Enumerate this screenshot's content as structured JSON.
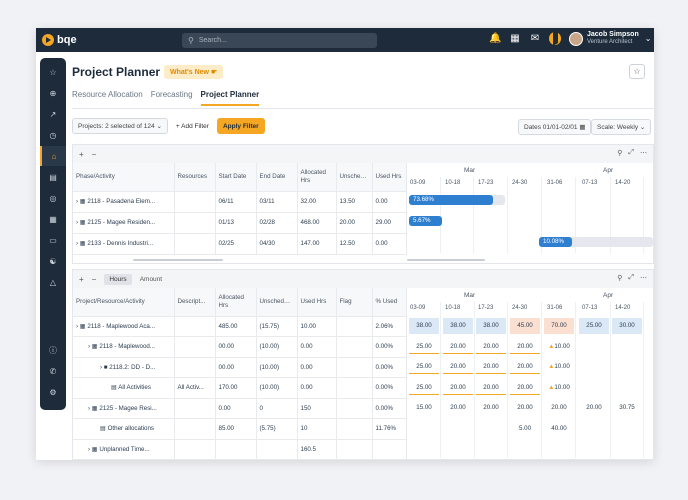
{
  "app": {
    "brand": "bqe",
    "search_placeholder": "Search...",
    "user_name": "Jacob Simpson",
    "user_role": "Venture Architect",
    "accent": "#f5a623",
    "nav_bg": "#1d2b3a"
  },
  "page": {
    "title": "Project Planner",
    "whats_new": "What's New"
  },
  "tabs": [
    "Resource Allocation",
    "Forecasting",
    "Project Planner"
  ],
  "filters": {
    "projects_label": "Projects:",
    "projects_value": "2 selected of 124",
    "add_filter": "+ Add Filter",
    "apply_filter": "Apply Filter",
    "dates_label": "Dates",
    "dates_value": "01/01-02/01",
    "scale_label": "Scale:",
    "scale_value": "Weekly"
  },
  "panel1": {
    "headers": [
      "Phase/Activity",
      "Resources",
      "Start Date",
      "End Date",
      "Allocated Hrs",
      "Unscheduled...",
      "Used Hrs"
    ],
    "rows": [
      {
        "name": "2118 - Pasadena Elem...",
        "res": "",
        "start": "06/11",
        "end": "03/11",
        "alloc": "32.00",
        "unsch": "13.50",
        "used": "0.00"
      },
      {
        "name": "2125 - Magee Residen...",
        "res": "",
        "start": "01/13",
        "end": "02/28",
        "alloc": "468.00",
        "unsch": "20.00",
        "used": "29.00"
      },
      {
        "name": "2133 - Dennis Industri...",
        "res": "",
        "start": "02/25",
        "end": "04/30",
        "alloc": "147.00",
        "unsch": "12.50",
        "used": "0.00"
      }
    ],
    "months": [
      "Mar",
      "Apr"
    ],
    "weeks": [
      "03-09",
      "10-18",
      "17-23",
      "24-30",
      "31-06",
      "07-13",
      "14-20"
    ],
    "bars": [
      "73.68%",
      "5.67%",
      "10.08%"
    ]
  },
  "panel2": {
    "toggle_hours": "Hours",
    "toggle_amount": "Amount",
    "headers": [
      "Project/Resource/Activity",
      "Descript...",
      "Allocated Hrs",
      "Unscheduled...",
      "Used Hrs",
      "Flag",
      "% Used"
    ],
    "rows": [
      {
        "name": "2118 - Maplewood Aca...",
        "desc": "",
        "alloc": "485.00",
        "unsch": "(15.75)",
        "used": "10.00",
        "flag": "",
        "pct": "2.06%"
      },
      {
        "name": "2118 - Maplewood...",
        "desc": "",
        "alloc": "00.00",
        "unsch": "(10.00)",
        "used": "0.00",
        "flag": "",
        "pct": "0.00%"
      },
      {
        "name": "2118.2: DD - D...",
        "desc": "",
        "alloc": "00.00",
        "unsch": "(10.00)",
        "used": "0.00",
        "flag": "",
        "pct": "0.00%"
      },
      {
        "name": "All Activities",
        "desc": "All Activ...",
        "alloc": "170.00",
        "unsch": "(10.00)",
        "used": "0.00",
        "flag": "",
        "pct": "0.00%"
      },
      {
        "name": "2125 - Magee Resi...",
        "desc": "",
        "alloc": "0.00",
        "unsch": "0",
        "used": "150",
        "flag": "",
        "pct": "0.00%"
      },
      {
        "name": "Other allocations",
        "desc": "",
        "alloc": "85.00",
        "unsch": "(5.75)",
        "used": "10",
        "flag": "",
        "pct": "11.76%"
      },
      {
        "name": "Unplanned Time...",
        "desc": "",
        "alloc": "",
        "unsch": "",
        "used": "160.5",
        "flag": "",
        "pct": ""
      }
    ],
    "months": [
      "Mar",
      "Apr"
    ],
    "weeks": [
      "03-09",
      "10-18",
      "17-23",
      "24-30",
      "31-06",
      "07-13",
      "14-20"
    ],
    "grid": [
      [
        "38.00",
        "38.00",
        "38.00",
        "45.00",
        "70.00",
        "25.00",
        "30.00"
      ],
      [
        "25.00",
        "20.00",
        "20.00",
        "20.00",
        "10.00",
        "",
        ""
      ],
      [
        "25.00",
        "20.00",
        "20.00",
        "20.00",
        "10.00",
        "",
        ""
      ],
      [
        "25.00",
        "20.00",
        "20.00",
        "20.00",
        "10.00",
        "",
        ""
      ],
      [
        "15.00",
        "20.00",
        "20.00",
        "20.00",
        "20.00",
        "20.00",
        "30.75"
      ],
      [
        "",
        "",
        "",
        "5.00",
        "40.00",
        "",
        ""
      ],
      [
        "",
        "",
        "",
        "",
        "",
        "",
        ""
      ]
    ]
  }
}
